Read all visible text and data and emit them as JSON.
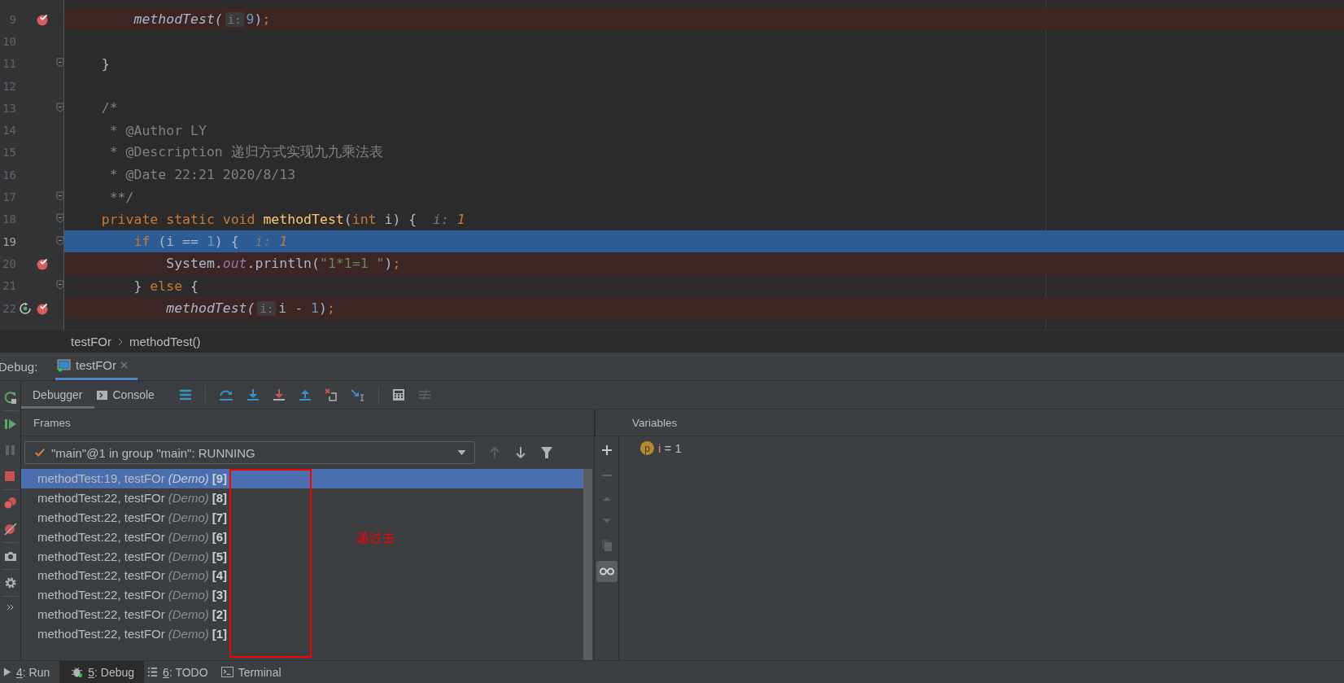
{
  "editor": {
    "lines": [
      {
        "number": "9",
        "breakpoint": true,
        "current": false,
        "fold": false,
        "tokens": [
          {
            "text": "        methodTest(",
            "kind": "call"
          },
          {
            "text": "i:",
            "kind": "param-hint"
          },
          {
            "text": "9",
            "kind": "number"
          },
          {
            "text": ")",
            "kind": "plain"
          },
          {
            "text": ";",
            "kind": "keyword"
          }
        ]
      },
      {
        "number": "10",
        "breakpoint": false,
        "current": false,
        "fold": false
      },
      {
        "number": "11",
        "breakpoint": false,
        "current": false,
        "fold": true,
        "tokens": [
          {
            "text": "    }",
            "kind": "plain"
          }
        ]
      },
      {
        "number": "12",
        "breakpoint": false,
        "current": false,
        "fold": false
      },
      {
        "number": "13",
        "breakpoint": false,
        "current": false,
        "fold": true,
        "tokens": [
          {
            "text": "    /*",
            "kind": "comment"
          }
        ]
      },
      {
        "number": "14",
        "breakpoint": false,
        "current": false,
        "fold": false,
        "tokens": [
          {
            "text": "     * @Author LY",
            "kind": "comment"
          }
        ]
      },
      {
        "number": "15",
        "breakpoint": false,
        "current": false,
        "fold": false,
        "tokens": [
          {
            "text": "     * @Description 递归方式实现九九乘法表",
            "kind": "comment"
          }
        ]
      },
      {
        "number": "16",
        "breakpoint": false,
        "current": false,
        "fold": false,
        "tokens": [
          {
            "text": "     * @Date 22:21 2020/8/13",
            "kind": "comment"
          }
        ]
      },
      {
        "number": "17",
        "breakpoint": false,
        "current": false,
        "fold": true,
        "tokens": [
          {
            "text": "     **/",
            "kind": "comment"
          }
        ]
      },
      {
        "number": "18",
        "breakpoint": false,
        "current": false,
        "fold": true,
        "tokens": [
          {
            "text": "    private static void ",
            "kind": "keyword"
          },
          {
            "text": "methodTest",
            "kind": "method"
          },
          {
            "text": "(",
            "kind": "plain"
          },
          {
            "text": "int",
            "kind": "keyword"
          },
          {
            "text": " i) {",
            "kind": "plain"
          },
          {
            "text": "  i: ",
            "kind": "hint-label"
          },
          {
            "text": "1",
            "kind": "hint-value"
          }
        ]
      },
      {
        "number": "19",
        "breakpoint": false,
        "current": true,
        "fold": true,
        "tokens": [
          {
            "text": "        if",
            "kind": "keyword"
          },
          {
            "text": " (i == ",
            "kind": "plain"
          },
          {
            "text": "1",
            "kind": "number"
          },
          {
            "text": ") {",
            "kind": "plain"
          },
          {
            "text": "  i: ",
            "kind": "hint-label"
          },
          {
            "text": "1",
            "kind": "hint-value"
          }
        ]
      },
      {
        "number": "20",
        "breakpoint": true,
        "current": false,
        "fold": false,
        "tokens": [
          {
            "text": "            System.",
            "kind": "plain"
          },
          {
            "text": "out",
            "kind": "field"
          },
          {
            "text": ".println(",
            "kind": "plain"
          },
          {
            "text": "\"1*1=1 \"",
            "kind": "string"
          },
          {
            "text": ")",
            "kind": "plain"
          },
          {
            "text": ";",
            "kind": "keyword"
          }
        ]
      },
      {
        "number": "21",
        "breakpoint": false,
        "current": false,
        "fold": true,
        "tokens": [
          {
            "text": "        } ",
            "kind": "plain"
          },
          {
            "text": "else",
            "kind": "keyword"
          },
          {
            "text": " {",
            "kind": "plain"
          }
        ]
      },
      {
        "number": "22",
        "breakpoint": true,
        "current": false,
        "fold": false,
        "reset_frame": true,
        "tokens": [
          {
            "text": "            methodTest(",
            "kind": "call"
          },
          {
            "text": "i:",
            "kind": "param-hint"
          },
          {
            "text": "i - ",
            "kind": "plain"
          },
          {
            "text": "1",
            "kind": "number"
          },
          {
            "text": ")",
            "kind": "plain"
          },
          {
            "text": ";",
            "kind": "keyword"
          }
        ]
      }
    ]
  },
  "breadcrumb": [
    "testFOr",
    "methodTest()"
  ],
  "debug_bar": {
    "label": "Debug:",
    "tabs": [
      {
        "label": "testFOr",
        "selected": true
      }
    ]
  },
  "debugger_tabs": [
    {
      "label": "Debugger",
      "selected": true,
      "kind": "text"
    },
    {
      "label": "Console",
      "selected": false,
      "kind": "console"
    }
  ],
  "frames": {
    "title": "Frames",
    "thread": "\"main\"@1 in group \"main\": RUNNING",
    "items": [
      {
        "method": "methodTest:19, testFOr",
        "class": "(Demo)",
        "depth": "[9]",
        "selected": true
      },
      {
        "method": "methodTest:22, testFOr",
        "class": "(Demo)",
        "depth": "[8]",
        "selected": false
      },
      {
        "method": "methodTest:22, testFOr",
        "class": "(Demo)",
        "depth": "[7]",
        "selected": false
      },
      {
        "method": "methodTest:22, testFOr",
        "class": "(Demo)",
        "depth": "[6]",
        "selected": false
      },
      {
        "method": "methodTest:22, testFOr",
        "class": "(Demo)",
        "depth": "[5]",
        "selected": false
      },
      {
        "method": "methodTest:22, testFOr",
        "class": "(Demo)",
        "depth": "[4]",
        "selected": false
      },
      {
        "method": "methodTest:22, testFOr",
        "class": "(Demo)",
        "depth": "[3]",
        "selected": false
      },
      {
        "method": "methodTest:22, testFOr",
        "class": "(Demo)",
        "depth": "[2]",
        "selected": false
      },
      {
        "method": "methodTest:22, testFOr",
        "class": "(Demo)",
        "depth": "[1]",
        "selected": false
      }
    ]
  },
  "annotation": {
    "text": "递过去"
  },
  "variables": {
    "title": "Variables",
    "items": [
      {
        "badge": "p",
        "name": "i",
        "value": " = 1"
      }
    ]
  },
  "bottom_tools": [
    {
      "mnemonic": "4",
      "label": ": Run",
      "selected": false,
      "kind": "run"
    },
    {
      "mnemonic": "5",
      "label": ": Debug",
      "selected": true,
      "kind": "debug"
    },
    {
      "mnemonic": "6",
      "label": ": TODO",
      "selected": false,
      "kind": "todo"
    },
    {
      "label": "Terminal",
      "selected": false,
      "kind": "terminal"
    }
  ]
}
